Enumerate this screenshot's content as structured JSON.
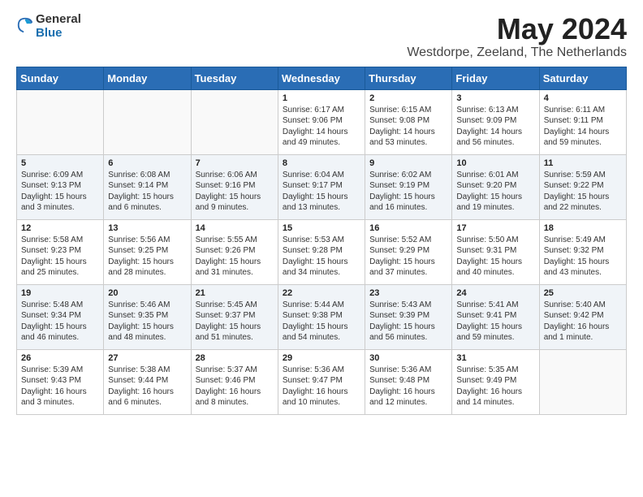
{
  "logo": {
    "general": "General",
    "blue": "Blue"
  },
  "title": {
    "month_year": "May 2024",
    "location": "Westdorpe, Zeeland, The Netherlands"
  },
  "days_header": [
    "Sunday",
    "Monday",
    "Tuesday",
    "Wednesday",
    "Thursday",
    "Friday",
    "Saturday"
  ],
  "weeks": [
    [
      {
        "day": "",
        "info": ""
      },
      {
        "day": "",
        "info": ""
      },
      {
        "day": "",
        "info": ""
      },
      {
        "day": "1",
        "info": "Sunrise: 6:17 AM\nSunset: 9:06 PM\nDaylight: 14 hours\nand 49 minutes."
      },
      {
        "day": "2",
        "info": "Sunrise: 6:15 AM\nSunset: 9:08 PM\nDaylight: 14 hours\nand 53 minutes."
      },
      {
        "day": "3",
        "info": "Sunrise: 6:13 AM\nSunset: 9:09 PM\nDaylight: 14 hours\nand 56 minutes."
      },
      {
        "day": "4",
        "info": "Sunrise: 6:11 AM\nSunset: 9:11 PM\nDaylight: 14 hours\nand 59 minutes."
      }
    ],
    [
      {
        "day": "5",
        "info": "Sunrise: 6:09 AM\nSunset: 9:13 PM\nDaylight: 15 hours\nand 3 minutes."
      },
      {
        "day": "6",
        "info": "Sunrise: 6:08 AM\nSunset: 9:14 PM\nDaylight: 15 hours\nand 6 minutes."
      },
      {
        "day": "7",
        "info": "Sunrise: 6:06 AM\nSunset: 9:16 PM\nDaylight: 15 hours\nand 9 minutes."
      },
      {
        "day": "8",
        "info": "Sunrise: 6:04 AM\nSunset: 9:17 PM\nDaylight: 15 hours\nand 13 minutes."
      },
      {
        "day": "9",
        "info": "Sunrise: 6:02 AM\nSunset: 9:19 PM\nDaylight: 15 hours\nand 16 minutes."
      },
      {
        "day": "10",
        "info": "Sunrise: 6:01 AM\nSunset: 9:20 PM\nDaylight: 15 hours\nand 19 minutes."
      },
      {
        "day": "11",
        "info": "Sunrise: 5:59 AM\nSunset: 9:22 PM\nDaylight: 15 hours\nand 22 minutes."
      }
    ],
    [
      {
        "day": "12",
        "info": "Sunrise: 5:58 AM\nSunset: 9:23 PM\nDaylight: 15 hours\nand 25 minutes."
      },
      {
        "day": "13",
        "info": "Sunrise: 5:56 AM\nSunset: 9:25 PM\nDaylight: 15 hours\nand 28 minutes."
      },
      {
        "day": "14",
        "info": "Sunrise: 5:55 AM\nSunset: 9:26 PM\nDaylight: 15 hours\nand 31 minutes."
      },
      {
        "day": "15",
        "info": "Sunrise: 5:53 AM\nSunset: 9:28 PM\nDaylight: 15 hours\nand 34 minutes."
      },
      {
        "day": "16",
        "info": "Sunrise: 5:52 AM\nSunset: 9:29 PM\nDaylight: 15 hours\nand 37 minutes."
      },
      {
        "day": "17",
        "info": "Sunrise: 5:50 AM\nSunset: 9:31 PM\nDaylight: 15 hours\nand 40 minutes."
      },
      {
        "day": "18",
        "info": "Sunrise: 5:49 AM\nSunset: 9:32 PM\nDaylight: 15 hours\nand 43 minutes."
      }
    ],
    [
      {
        "day": "19",
        "info": "Sunrise: 5:48 AM\nSunset: 9:34 PM\nDaylight: 15 hours\nand 46 minutes."
      },
      {
        "day": "20",
        "info": "Sunrise: 5:46 AM\nSunset: 9:35 PM\nDaylight: 15 hours\nand 48 minutes."
      },
      {
        "day": "21",
        "info": "Sunrise: 5:45 AM\nSunset: 9:37 PM\nDaylight: 15 hours\nand 51 minutes."
      },
      {
        "day": "22",
        "info": "Sunrise: 5:44 AM\nSunset: 9:38 PM\nDaylight: 15 hours\nand 54 minutes."
      },
      {
        "day": "23",
        "info": "Sunrise: 5:43 AM\nSunset: 9:39 PM\nDaylight: 15 hours\nand 56 minutes."
      },
      {
        "day": "24",
        "info": "Sunrise: 5:41 AM\nSunset: 9:41 PM\nDaylight: 15 hours\nand 59 minutes."
      },
      {
        "day": "25",
        "info": "Sunrise: 5:40 AM\nSunset: 9:42 PM\nDaylight: 16 hours\nand 1 minute."
      }
    ],
    [
      {
        "day": "26",
        "info": "Sunrise: 5:39 AM\nSunset: 9:43 PM\nDaylight: 16 hours\nand 3 minutes."
      },
      {
        "day": "27",
        "info": "Sunrise: 5:38 AM\nSunset: 9:44 PM\nDaylight: 16 hours\nand 6 minutes."
      },
      {
        "day": "28",
        "info": "Sunrise: 5:37 AM\nSunset: 9:46 PM\nDaylight: 16 hours\nand 8 minutes."
      },
      {
        "day": "29",
        "info": "Sunrise: 5:36 AM\nSunset: 9:47 PM\nDaylight: 16 hours\nand 10 minutes."
      },
      {
        "day": "30",
        "info": "Sunrise: 5:36 AM\nSunset: 9:48 PM\nDaylight: 16 hours\nand 12 minutes."
      },
      {
        "day": "31",
        "info": "Sunrise: 5:35 AM\nSunset: 9:49 PM\nDaylight: 16 hours\nand 14 minutes."
      },
      {
        "day": "",
        "info": ""
      }
    ]
  ]
}
